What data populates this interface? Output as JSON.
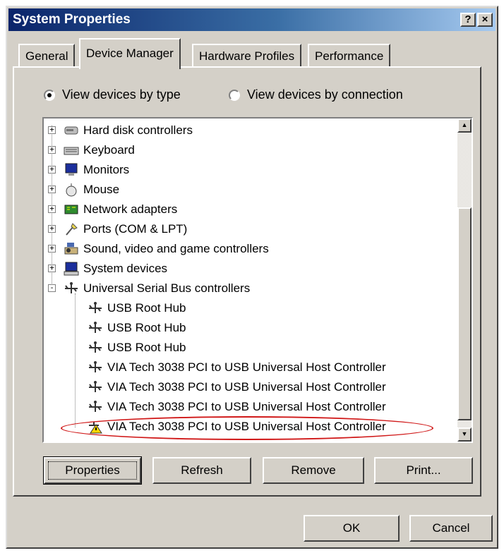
{
  "window": {
    "title": "System Properties",
    "help_label": "?",
    "close_label": "×"
  },
  "tabs": [
    {
      "label": "General",
      "active": false
    },
    {
      "label": "Device Manager",
      "active": true
    },
    {
      "label": "Hardware Profiles",
      "active": false
    },
    {
      "label": "Performance",
      "active": false
    }
  ],
  "radios": [
    {
      "label": "View devices by type",
      "checked": true
    },
    {
      "label": "View devices by connection",
      "checked": false
    }
  ],
  "devices": [
    {
      "label": "Hard disk controllers",
      "icon": "hard-disk-icon",
      "expander": "+"
    },
    {
      "label": "Keyboard",
      "icon": "keyboard-icon",
      "expander": "+"
    },
    {
      "label": "Monitors",
      "icon": "monitor-icon",
      "expander": "+"
    },
    {
      "label": "Mouse",
      "icon": "mouse-icon",
      "expander": "+"
    },
    {
      "label": "Network adapters",
      "icon": "network-adapter-icon",
      "expander": "+"
    },
    {
      "label": "Ports (COM & LPT)",
      "icon": "port-icon",
      "expander": "+"
    },
    {
      "label": "Sound, video and game controllers",
      "icon": "sound-icon",
      "expander": "+"
    },
    {
      "label": "System devices",
      "icon": "computer-icon",
      "expander": "+"
    },
    {
      "label": "Universal Serial Bus controllers",
      "icon": "usb-icon",
      "expander": "-"
    }
  ],
  "usb_children": [
    {
      "label": "USB Root Hub",
      "icon": "usb-icon"
    },
    {
      "label": "USB Root Hub",
      "icon": "usb-icon"
    },
    {
      "label": "USB Root Hub",
      "icon": "usb-icon"
    },
    {
      "label": "VIA Tech 3038 PCI to USB Universal Host Controller",
      "icon": "usb-icon"
    },
    {
      "label": "VIA Tech 3038 PCI to USB Universal Host Controller",
      "icon": "usb-icon"
    },
    {
      "label": "VIA Tech 3038 PCI to USB Universal Host Controller",
      "icon": "usb-icon"
    },
    {
      "label": "VIA Tech 3038 PCI to USB Universal Host Controller",
      "icon": "usb-warning-icon"
    }
  ],
  "buttons": {
    "properties": "Properties",
    "refresh": "Refresh",
    "remove": "Remove",
    "print": "Print...",
    "ok": "OK",
    "cancel": "Cancel"
  },
  "colors": {
    "highlight_oval": "#d01818",
    "titlebar": "#0a246a"
  }
}
